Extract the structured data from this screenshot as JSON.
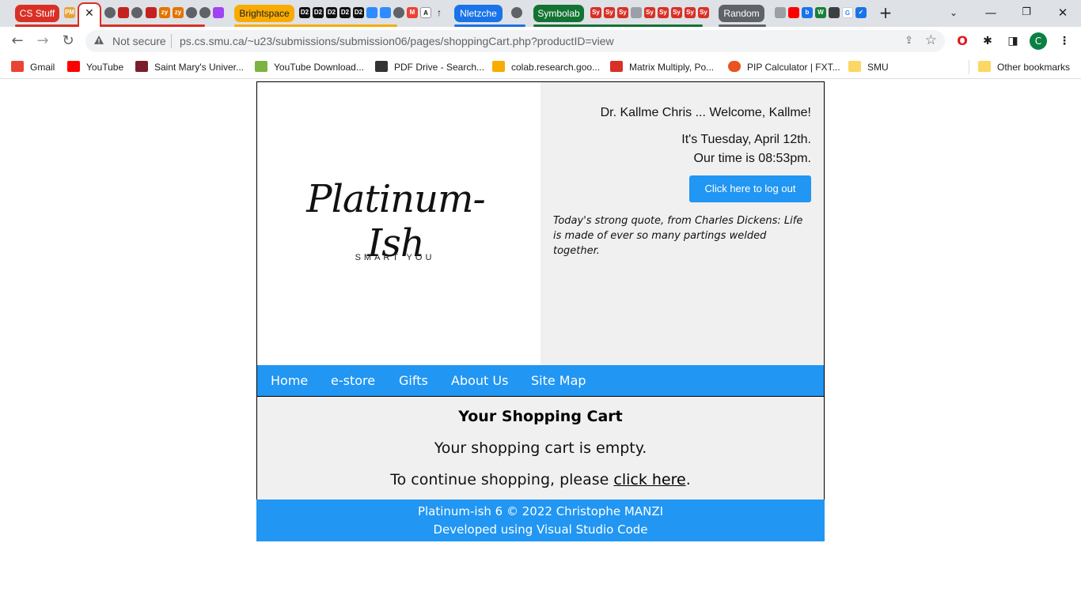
{
  "browser": {
    "tab_groups": [
      {
        "label": "CS Stuff",
        "color": "#d93025"
      },
      {
        "label": "Brightspace",
        "color": "#f9ab00"
      },
      {
        "label": "Nletzche",
        "color": "#1a73e8"
      },
      {
        "label": "Symbolab",
        "color": "#137333"
      },
      {
        "label": "Random",
        "color": "#5f6368"
      }
    ],
    "active_tab_close": "✕",
    "new_tab": "+",
    "url_warning": "Not secure",
    "url": "ps.cs.smu.ca/~u23/submissions/submission06/pages/shoppingCart.php?productID=view",
    "profile_initial": "C",
    "bookmarks": [
      {
        "label": "Gmail",
        "color": "#ea4335"
      },
      {
        "label": "YouTube",
        "color": "#ff0000"
      },
      {
        "label": "Saint Mary's Univer...",
        "color": "#7b1e2c"
      },
      {
        "label": "YouTube Download...",
        "color": "#7cb342"
      },
      {
        "label": "PDF Drive - Search...",
        "color": "#333333"
      },
      {
        "label": "colab.research.goo...",
        "color": "#f9ab00"
      },
      {
        "label": "Matrix Multiply, Po...",
        "color": "#d93025"
      },
      {
        "label": "PIP Calculator | FXT...",
        "color": "#e8541e"
      },
      {
        "label": "SMU",
        "color": "#fdd663"
      }
    ],
    "other_bookmarks": "Other bookmarks"
  },
  "page": {
    "logo_text": "Platinum-Ish",
    "logo_tagline": "SMART YOU",
    "welcome": "Dr. Kallme Chris ... Welcome, Kallme!",
    "date": "It's Tuesday, April 12th.",
    "time": "Our time is 08:53pm.",
    "logout_label": "Click here to log out",
    "quote": "Today's strong quote, from Charles Dickens: Life is made of ever so many partings welded together.",
    "nav": [
      "Home",
      "e-store",
      "Gifts",
      "About Us",
      "Site Map"
    ],
    "cart_title": "Your Shopping Cart",
    "cart_empty": "Your shopping cart is empty.",
    "cart_continue_prefix": "To continue shopping, please ",
    "cart_continue_link": "click here",
    "cart_continue_suffix": ".",
    "footer_line1": "Platinum-ish 6 © 2022 Christophe MANZI",
    "footer_line2": "Developed using Visual Studio Code"
  }
}
